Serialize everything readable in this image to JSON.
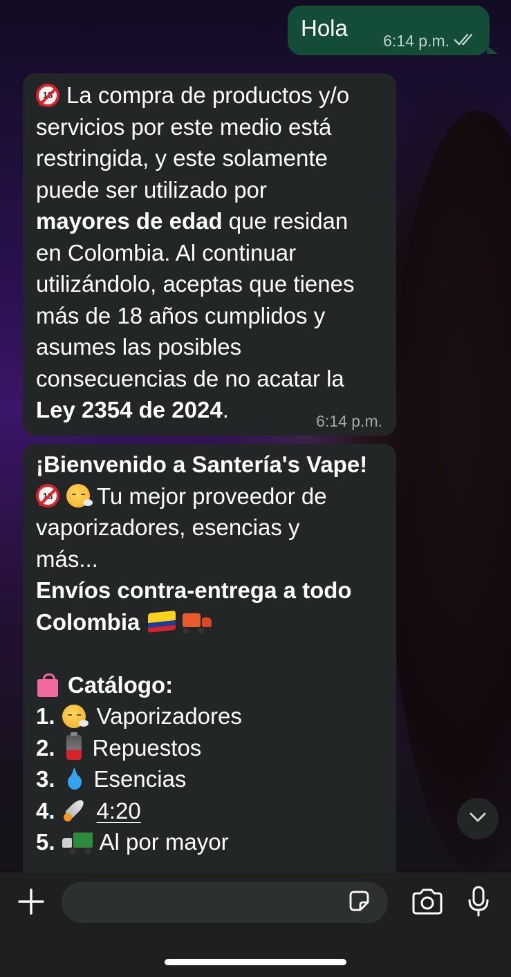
{
  "chat": {
    "outgoing": {
      "text": "Hola",
      "time": "6:14 p.m.",
      "status": "read"
    },
    "notice": {
      "lines": [
        [
          "",
          "La compra de productos y/o"
        ],
        [
          "servicios por este medio está"
        ],
        [
          "restringida, y este solamente"
        ],
        [
          "puede ser utilizado por"
        ],
        [
          "mayores de edad",
          " que residan"
        ],
        [
          "en Colombia. Al continuar"
        ],
        [
          "utilizándolo, aceptas que tienes"
        ],
        [
          "más de 18 años cumplidos y"
        ],
        [
          "asumes las posibles"
        ],
        [
          "consecuencias de no acatar la"
        ],
        [
          "Ley 2354 de 2024",
          "."
        ]
      ],
      "line1": "La compra de productos y/o",
      "line2": "servicios por este medio está",
      "line3": "restringida, y este solamente",
      "line4": "puede ser utilizado por",
      "line5_bold": "mayores de edad",
      "line5_rest": " que residan",
      "line6": "en Colombia. Al continuar",
      "line7": "utilizándolo, aceptas que tienes",
      "line8": "más de 18 años cumplidos y",
      "line9": "asumes las posibles",
      "line10": "consecuencias de no acatar la",
      "line11_bold": "Ley 2354 de 2024",
      "line11_rest": ".",
      "time": "6:14 p.m.",
      "icon": "no-under-eighteen-emoji"
    },
    "welcome": {
      "title": "¡Bienvenido a Santería's Vape!",
      "intro1": "Tu mejor proveedor de",
      "intro2": "vaporizadores, esencias y",
      "intro3": "más...",
      "shipping1": "Envíos contra-entrega a todo",
      "shipping2": "Colombia",
      "catalog_title": "Catálogo:",
      "items": [
        {
          "num": "1.",
          "label": "Vaporizadores",
          "icon": "face-exhaling-emoji"
        },
        {
          "num": "2.",
          "label": "Repuestos",
          "icon": "battery-emoji"
        },
        {
          "num": "3.",
          "label": "Esencias",
          "icon": "droplet-emoji"
        },
        {
          "num": "4.",
          "label": "4:20",
          "icon": "rocket-emoji"
        },
        {
          "num": "5.",
          "label": "Al por mayor",
          "icon": "lorry-emoji"
        }
      ]
    }
  },
  "composer": {
    "placeholder": "",
    "value": ""
  },
  "colors": {
    "outgoing_bubble": "#144d37",
    "incoming_bubble": "#232626",
    "bottom_bar": "#1e1f1f"
  }
}
